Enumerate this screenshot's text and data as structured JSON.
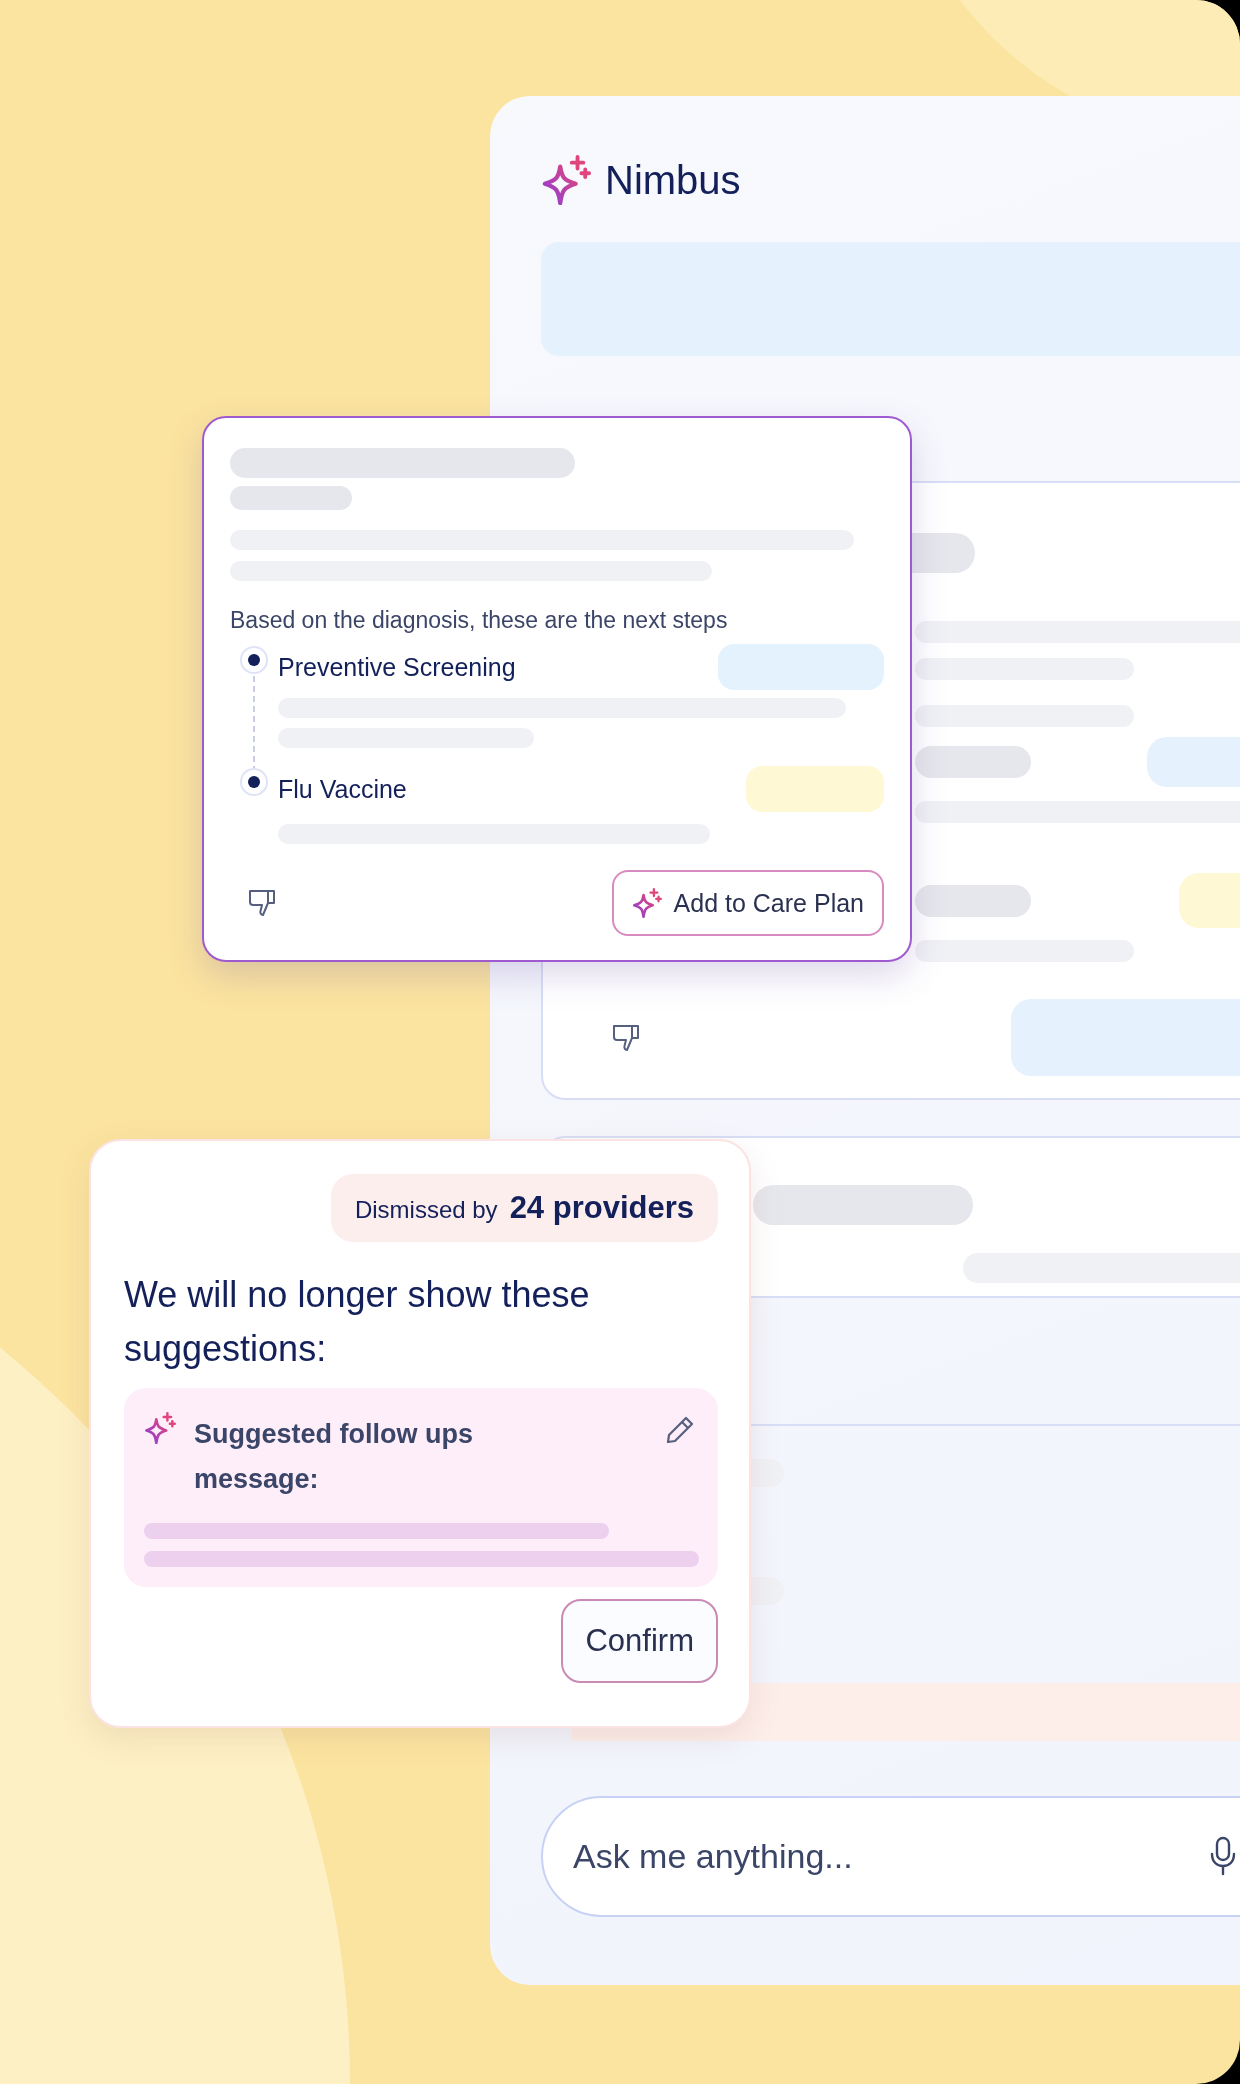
{
  "app": {
    "name": "Nimbus"
  },
  "next_steps_card": {
    "intro": "Based on the diagnosis, these are the next steps",
    "steps": [
      {
        "label": "Preventive Screening",
        "color": "#e3f2fd"
      },
      {
        "label": "Flu Vaccine",
        "color": "#fff8d4"
      }
    ],
    "action": "Add to Care Plan"
  },
  "dismiss_card": {
    "badge_prefix": "Dismissed by",
    "badge_count": "24 providers",
    "message": "We will no longer show these suggestions:",
    "suggestion": "Suggested follow ups message:",
    "confirm": "Confirm"
  },
  "chat_input": {
    "placeholder": "Ask me anything..."
  }
}
